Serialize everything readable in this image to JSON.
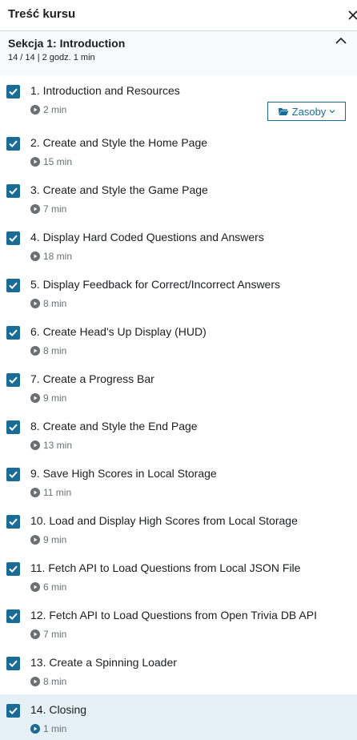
{
  "header": {
    "title": "Treść kursu"
  },
  "section": {
    "title": "Sekcja 1: Introduction",
    "meta": "14 / 14 | 2 godz. 1 min"
  },
  "resources_button": {
    "label": "Zasoby"
  },
  "lessons": [
    {
      "title": "1. Introduction and Resources",
      "duration": "2 min",
      "completed": true
    },
    {
      "title": "2. Create and Style the Home Page",
      "duration": "15 min",
      "completed": true
    },
    {
      "title": "3. Create and Style the Game Page",
      "duration": "7 min",
      "completed": true
    },
    {
      "title": "4. Display Hard Coded Questions and Answers",
      "duration": "18 min",
      "completed": true
    },
    {
      "title": "5. Display Feedback for Correct/Incorrect Answers",
      "duration": "8 min",
      "completed": true
    },
    {
      "title": "6. Create Head's Up Display (HUD)",
      "duration": "8 min",
      "completed": true
    },
    {
      "title": "7. Create a Progress Bar",
      "duration": "9 min",
      "completed": true
    },
    {
      "title": "8. Create and Style the End Page",
      "duration": "13 min",
      "completed": true
    },
    {
      "title": "9. Save High Scores in Local Storage",
      "duration": "11 min",
      "completed": true
    },
    {
      "title": "10. Load and Display High Scores from Local Storage",
      "duration": "9 min",
      "completed": true
    },
    {
      "title": "11. Fetch API to Load Questions from Local JSON File",
      "duration": "6 min",
      "completed": true
    },
    {
      "title": "12. Fetch API to Load Questions from Open Trivia DB API",
      "duration": "7 min",
      "completed": true
    },
    {
      "title": "13. Create a Spinning Loader",
      "duration": "8 min",
      "completed": true
    },
    {
      "title": "14. Closing",
      "duration": "1 min",
      "completed": true,
      "active": true
    }
  ],
  "colors": {
    "accent": "#1a6b96",
    "active_row": "#e5f1f6",
    "section_bg": "#f7f9fa",
    "muted_text": "#6a6f73"
  },
  "icons": [
    "close-icon",
    "chevron-up-icon",
    "checkbox-checked-icon",
    "play-circle-icon",
    "folder-open-icon",
    "chevron-down-icon"
  ]
}
